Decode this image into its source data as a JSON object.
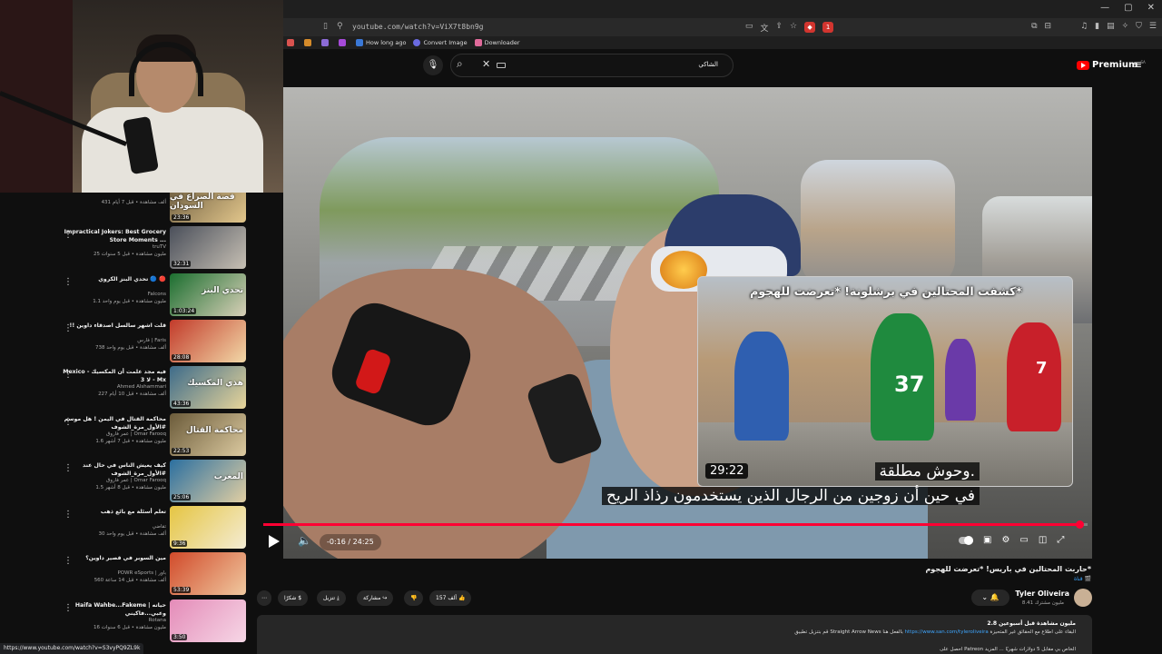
{
  "browser": {
    "url": "youtube.com/watch?v=ViX7t8bn9g",
    "bookmarks": [
      "How long ago",
      "Convert Image",
      "Downloader"
    ],
    "ext_badge": "1",
    "window_controls": [
      "—",
      "▢",
      "✕"
    ]
  },
  "masthead": {
    "search_text": "الشاكي",
    "logo_text": "Premium",
    "logo_region": "SA"
  },
  "sidebar": {
    "items": [
      {
        "title": "",
        "channel": "",
        "meta": "431 ألف مشاهدة • قبل 7 أيام",
        "duration": "23:36",
        "thumb_text": "قصة الصراع في السودان",
        "thumb_colors": [
          "#6a5a3e",
          "#e3c78c"
        ]
      },
      {
        "title": "Impractical Jokers: Best Grocery Store Moments ...",
        "channel": "truTV",
        "meta": "25 مليون مشاهدة • قبل 5 سنوات",
        "duration": "32:31",
        "thumb_text": "",
        "thumb_colors": [
          "#4a4f5a",
          "#c7c0b4"
        ]
      },
      {
        "title": "تحدي البنز الكروي 🔵 🔴",
        "channel": "Falcons",
        "meta": "1.1 مليون مشاهدة • قبل يوم واحد",
        "duration": "1:03:24",
        "thumb_text": "تحدي البنز",
        "thumb_colors": [
          "#1b6e2f",
          "#d9d0b8"
        ]
      },
      {
        "title": "!! قلت اشهر سالسل اصدقاء داوين",
        "channel": "فارس | Faris",
        "meta": "738 ألف مشاهدة • قبل يوم واحد",
        "duration": "28:08",
        "thumb_text": "",
        "thumb_colors": [
          "#c23a2a",
          "#f2d9a8"
        ]
      },
      {
        "title": "Mexico - فيه مجد علمت أن المكسيك لا 3 - Mx",
        "channel": "Ahmed Alshammari",
        "meta": "227 ألف مشاهدة • قبل 10 أيام",
        "duration": "43:36",
        "thumb_text": "هذي المكسيك",
        "thumb_colors": [
          "#3d6b8a",
          "#e8d59a"
        ]
      },
      {
        "title": "محاكمة القتال في اليمن ! هل موسم #الأول_مرة_الشوف",
        "channel": "عمر فاروق | Omar Farooq",
        "meta": "1.6 مليون مشاهدة • قبل 7 أشهر",
        "duration": "22:53",
        "thumb_text": "محاكمة القتال",
        "thumb_colors": [
          "#6b5b3a",
          "#dccaa0"
        ]
      },
      {
        "title": "كيف يعيش الناس في حال عند #الأول_مرة_الشوف",
        "channel": "عمر فاروق | Omar Farooq",
        "meta": "1.5 مليون مشاهدة • قبل 8 أشهر",
        "duration": "25:06",
        "thumb_text": "المغرب",
        "thumb_colors": [
          "#2b6fa0",
          "#e2cfa3"
        ]
      },
      {
        "title": "تعلم أسئلة مع بائع ذهب",
        "channel": "تقاضي",
        "meta": "30 ألف مشاهدة • قبل يوم واحد",
        "duration": "9:36",
        "thumb_text": "",
        "thumb_colors": [
          "#e5c542",
          "#f4ecd4"
        ]
      },
      {
        "title": "مين السوبر في قصير داوين؟",
        "channel": "POWR eSports | باور",
        "meta": "560 ألف مشاهدة • قبل 14 ساعة",
        "duration": "53:39",
        "thumb_text": "",
        "thumb_colors": [
          "#d14a2a",
          "#f0c9a0"
        ]
      },
      {
        "title": "Haifa Wahbe...Fakeme | حياته وعبي...فاكيني",
        "channel": "Rotana",
        "meta": "16 مليون مشاهدة • قبل 6 سنوات",
        "duration": "3:50",
        "thumb_text": "",
        "thumb_colors": [
          "#e48bb8",
          "#f6d7e6"
        ]
      }
    ],
    "status_url": "https://www.youtube.com/watch?v=S3vyPQ9ZL9k"
  },
  "player": {
    "inset_title": "كشفت المحتالين في برشلونة! *تعرضت للهجوم*",
    "inset_duration": "29:22",
    "caption_line1": "وحوش مطلقة.",
    "caption_line2": "في حين أن زوجين من الرجال الذين يستخدمون رذاذ الريح",
    "time": "-0:16 / 24:25",
    "progress": 0.99,
    "jersey_37": "37",
    "jersey_7": "7"
  },
  "video": {
    "title": "حاربت المحتالين في باريس! *تعرضت للهجوم*",
    "badge": "قناة 🎬",
    "channel_name": "Tyler Oliveira",
    "channel_subs": "8.41 مليون مشترك",
    "likes": "157 ألف",
    "share": "مشاركة",
    "download": "تنزيل",
    "thanks": "شكرًا",
    "more": "⋯"
  },
  "description": {
    "stats": "2.8 مليون مشاهدة  قبل أسبوعين",
    "line2_text": "البقاء على اطلاع مع الحقائق غير المتحيزة",
    "line2_link": "https://www.san.com/tyleroliveira",
    "line2_suffix": "قم بتنزيل تطبيق Straight Arrow News بالفعل هنا",
    "line3": "احصل على Patreon الخاص بي مقابل 5 دولارات شهريًا ... المزيد"
  },
  "colors": {
    "accent": "#ff0033",
    "link": "#3ea6ff",
    "background": "#0f0f0f"
  }
}
